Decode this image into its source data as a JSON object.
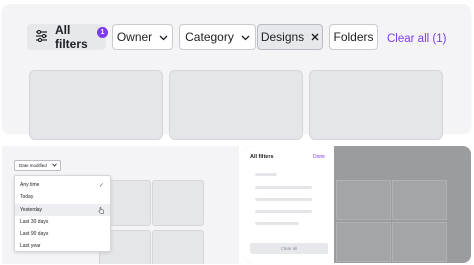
{
  "filter_bar": {
    "all_filters_label": "All filters",
    "all_filters_count": "1",
    "owner_label": "Owner",
    "category_label": "Category",
    "designs_label": "Designs",
    "folders_label": "Folders",
    "clear_all_label": "Clear all (1)"
  },
  "date_panel": {
    "chip_label": "Date modified",
    "options": [
      {
        "label": "Any time",
        "selected": true
      },
      {
        "label": "Today",
        "selected": false
      },
      {
        "label": "Yesterday",
        "selected": false
      },
      {
        "label": "Last 30 days",
        "selected": false
      },
      {
        "label": "Last 90 days",
        "selected": false
      },
      {
        "label": "Last year",
        "selected": false
      }
    ]
  },
  "filters_sidebar": {
    "title": "All filters",
    "done_label": "Done",
    "clear_all_label": "Clear all"
  },
  "colors": {
    "accent": "#7d3cf0",
    "panel_bg": "#f4f4f6",
    "overlay_bg": "#9a9c9f"
  }
}
